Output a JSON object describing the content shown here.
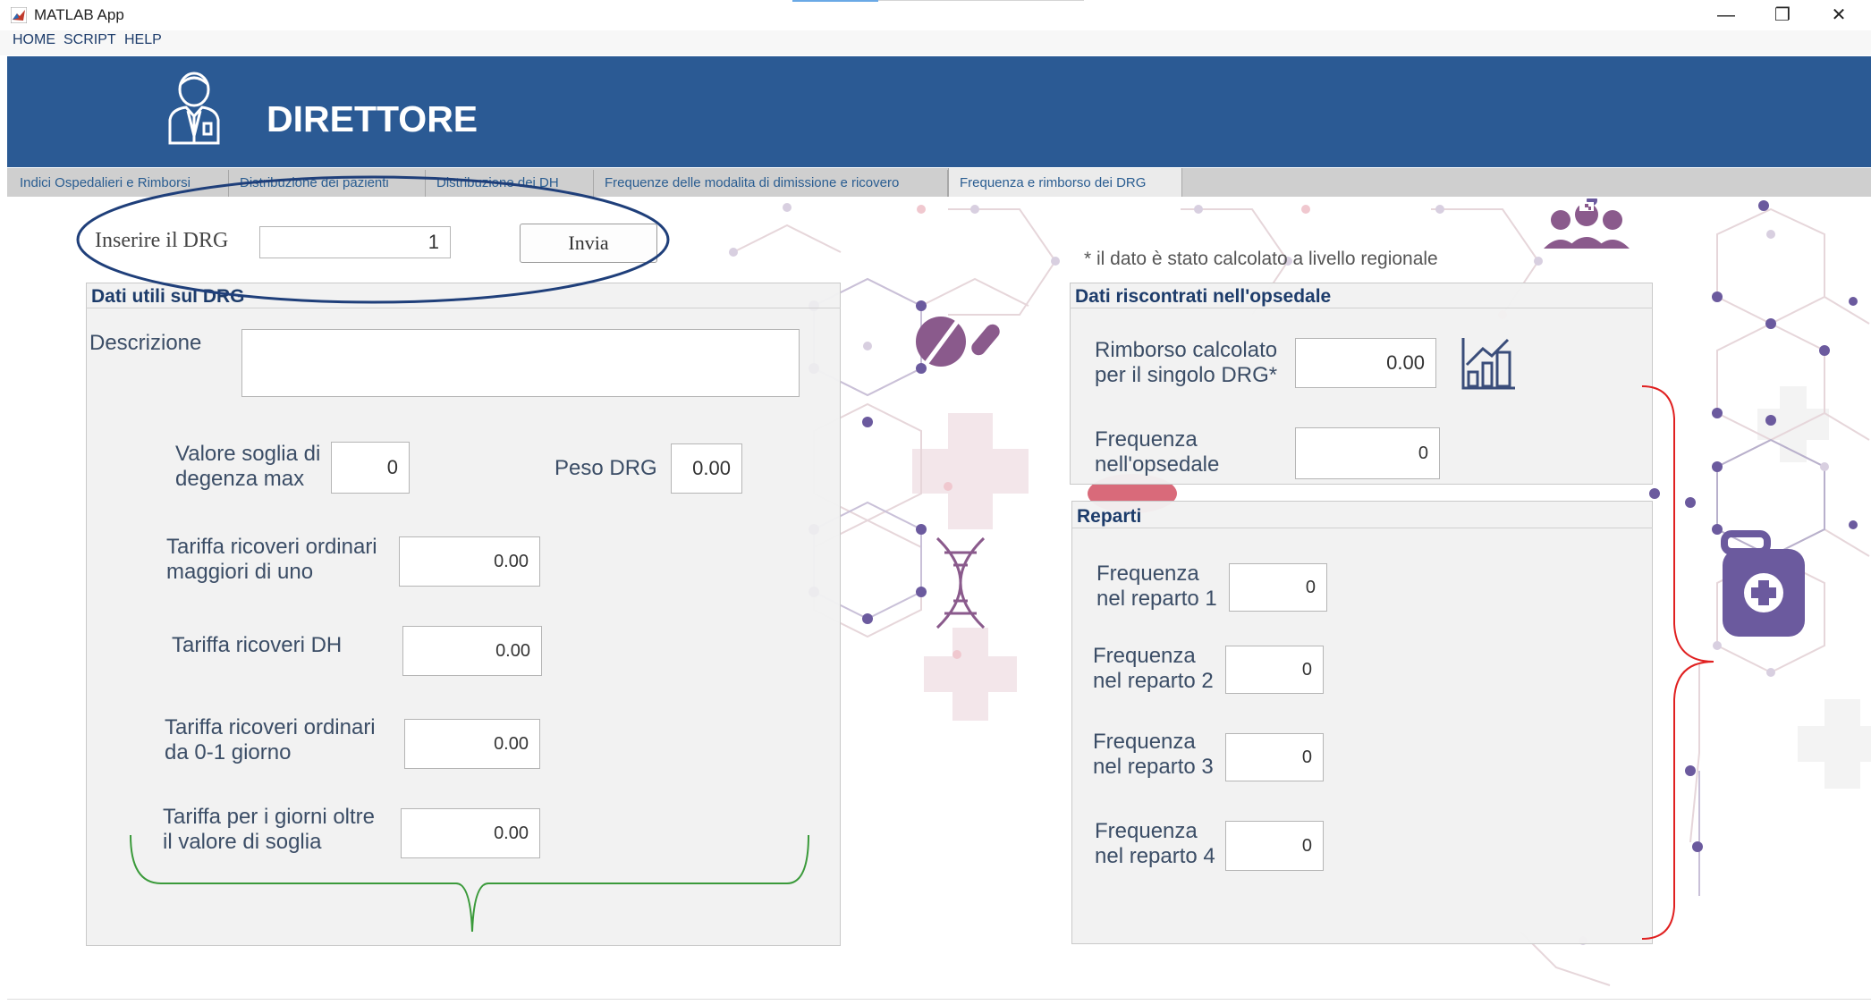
{
  "window": {
    "title": "MATLAB App",
    "controls": {
      "minimize": "—",
      "restore": "❐",
      "close": "✕"
    }
  },
  "menu": [
    "HOME",
    "SCRIPT",
    "HELP"
  ],
  "banner": {
    "title": "DIRETTORE",
    "icon": "doctor-icon"
  },
  "tabs": [
    "Indici Ospedalieri e Rimborsi",
    "Distribuzione dei pazienti",
    "Distribuzione dei DH",
    "Frequenze delle modalita di dimissione e ricovero",
    "Frequenza e rimborso dei DRG"
  ],
  "active_tab": "Frequenza e rimborso dei DRG",
  "drg_input": {
    "label": "Inserire il DRG",
    "value": "1",
    "button": "Invia"
  },
  "note": "* il dato è stato calcolato a livello regionale",
  "drg_panel": {
    "title": "Dati utili sul DRG",
    "descrizione_label": "Descrizione",
    "descrizione_value": "",
    "valore_soglia": {
      "label1": "Valore soglia di",
      "label2": "degenza max",
      "value": "0"
    },
    "peso_drg": {
      "label": "Peso DRG",
      "value": "0.00"
    },
    "tariffa_ordinari": {
      "label1": "Tariffa ricoveri ordinari",
      "label2": "maggiori di uno",
      "value": "0.00"
    },
    "tariffa_dh": {
      "label": "Tariffa ricoveri DH",
      "value": "0.00"
    },
    "tariffa_01": {
      "label1": "Tariffa ricoveri ordinari",
      "label2": "da 0-1 giorno",
      "value": "0.00"
    },
    "tariffa_oltre": {
      "label1": "Tariffa per i giorni oltre",
      "label2": "il valore di soglia",
      "value": "0.00"
    }
  },
  "ospedale_panel": {
    "title": "Dati riscontrati nell'opsedale",
    "rimborso": {
      "label1": "Rimborso calcolato",
      "label2": "per il singolo DRG*",
      "value": "0.00"
    },
    "frequenza": {
      "label1": "Frequenza",
      "label2": "nell'opsedale",
      "value": "0"
    }
  },
  "reparti_panel": {
    "title": "Reparti",
    "items": [
      {
        "label1": "Frequenza",
        "label2": "nel reparto 1",
        "value": "0"
      },
      {
        "label1": "Frequenza",
        "label2": "nel reparto 2",
        "value": "0"
      },
      {
        "label1": "Frequenza",
        "label2": "nel reparto 3",
        "value": "0"
      },
      {
        "label1": "Frequenza",
        "label2": "nel reparto 4",
        "value": "0"
      }
    ]
  },
  "colors": {
    "banner": "#2b5a94",
    "title_text": "#1d3c6b",
    "annotation_ellipse": "#1f3f7a",
    "annotation_green": "#3a9a3a",
    "annotation_red": "#e02020",
    "decor_purple": "#6b5a9e",
    "decor_pink": "#f0c8cf"
  }
}
